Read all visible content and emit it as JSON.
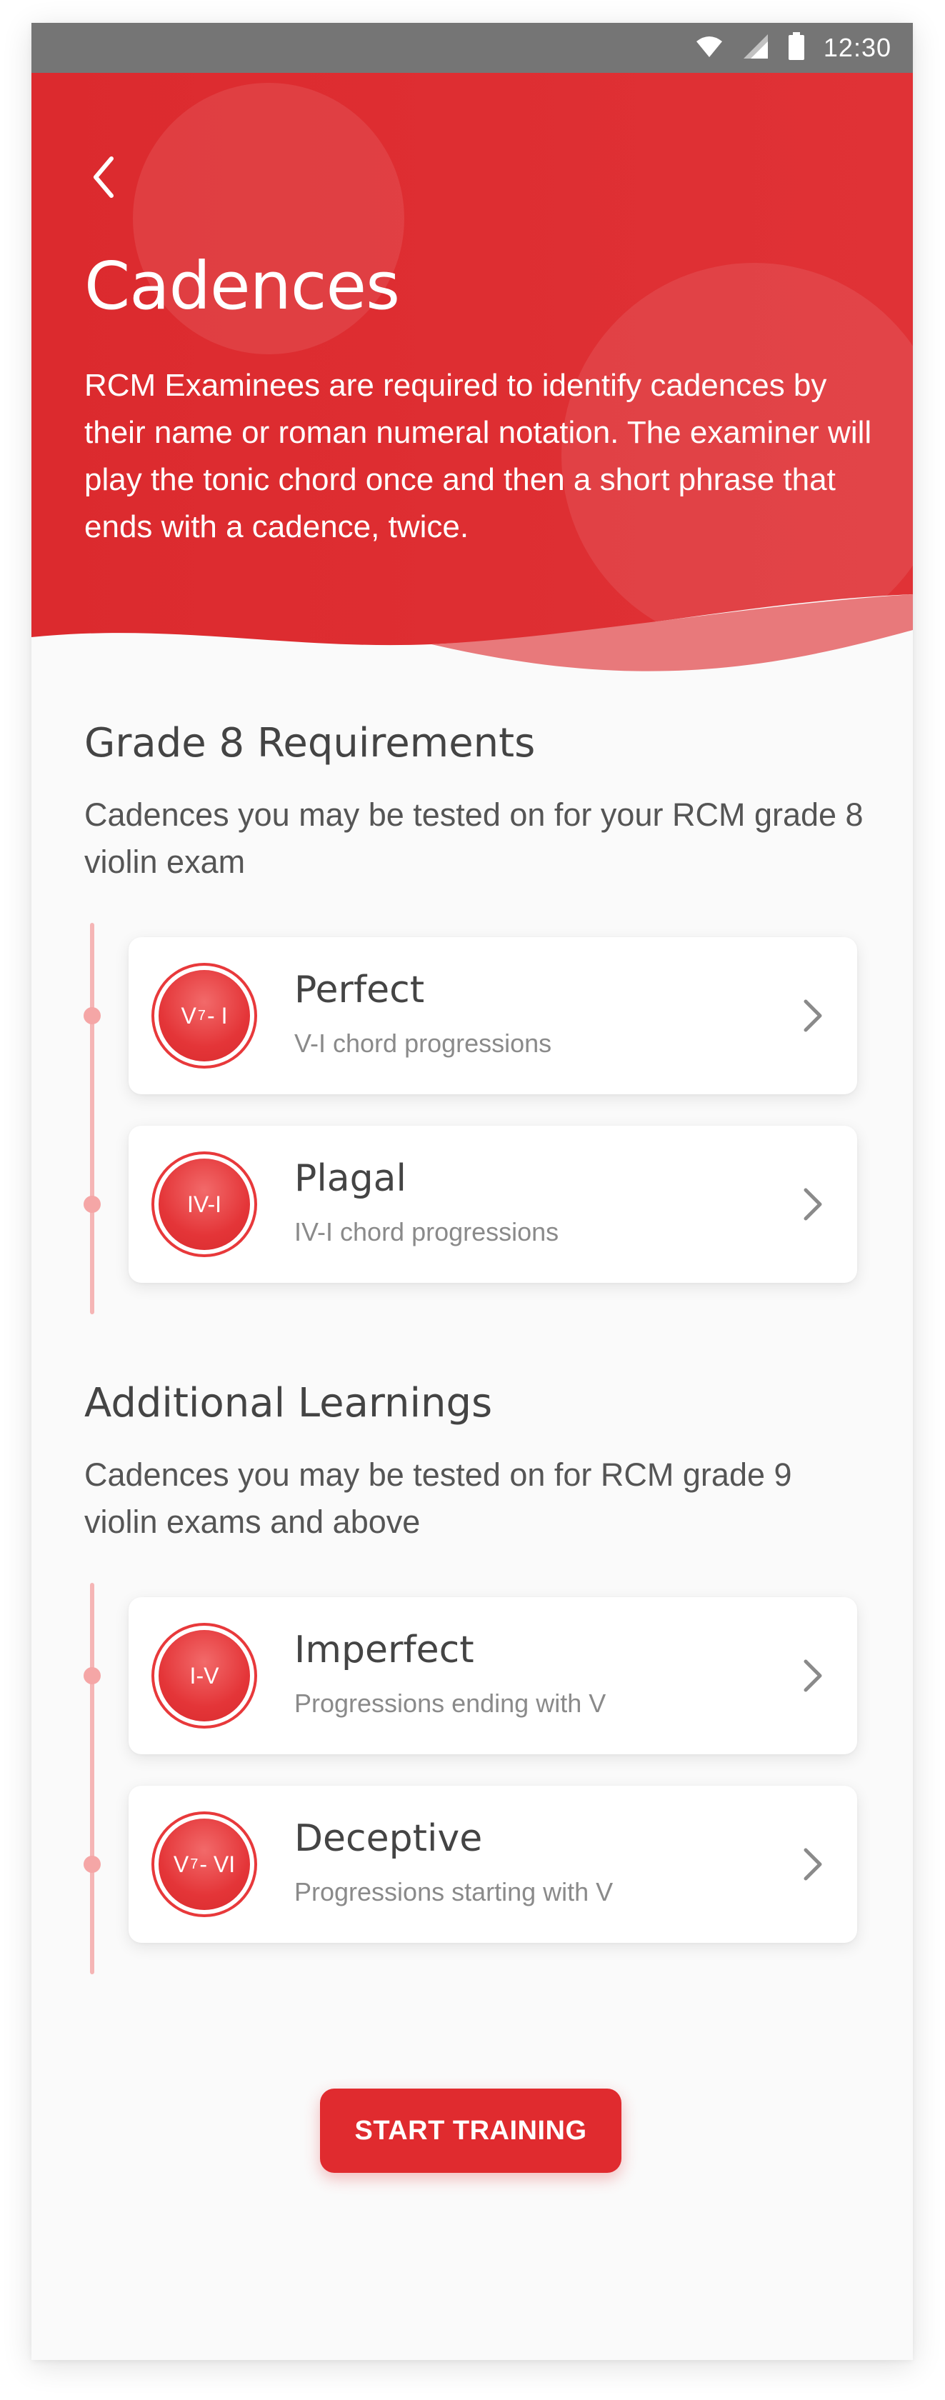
{
  "status_bar": {
    "time": "12:30",
    "icons": [
      "wifi-icon",
      "cell-signal-icon",
      "battery-icon"
    ]
  },
  "header": {
    "back_icon": "chevron-left-icon",
    "title": "Cadences",
    "description": "RCM Examinees are required to identify cadences by their name or roman numeral notation. The examiner will play the tonic chord once and then a short phrase that ends with a cadence, twice."
  },
  "sections": [
    {
      "title": "Grade 8 Requirements",
      "description": "Cadences you may be tested on for your RCM grade 8 violin exam",
      "items": [
        {
          "badge_main": "V",
          "badge_sup": "7",
          "badge_rest": "- I",
          "title": "Perfect",
          "subtitle": "V-I chord progressions"
        },
        {
          "badge_main": "IV-I",
          "badge_sup": "",
          "badge_rest": "",
          "title": "Plagal",
          "subtitle": "IV-I chord progressions"
        }
      ]
    },
    {
      "title": "Additional Learnings",
      "description": "Cadences you may be tested on for RCM grade 9 violin exams and above",
      "items": [
        {
          "badge_main": "I-V",
          "badge_sup": "",
          "badge_rest": "",
          "title": "Imperfect",
          "subtitle": "Progressions ending with V"
        },
        {
          "badge_main": "V",
          "badge_sup": "7",
          "badge_rest": "- VI",
          "title": "Deceptive",
          "subtitle": "Progressions starting with V"
        }
      ]
    }
  ],
  "cta": {
    "label": "START TRAINING"
  },
  "colors": {
    "accent": "#e02b2f",
    "header_red": "#dd2c2f",
    "timeline": "#f5b5b5",
    "background": "#fafafa"
  }
}
